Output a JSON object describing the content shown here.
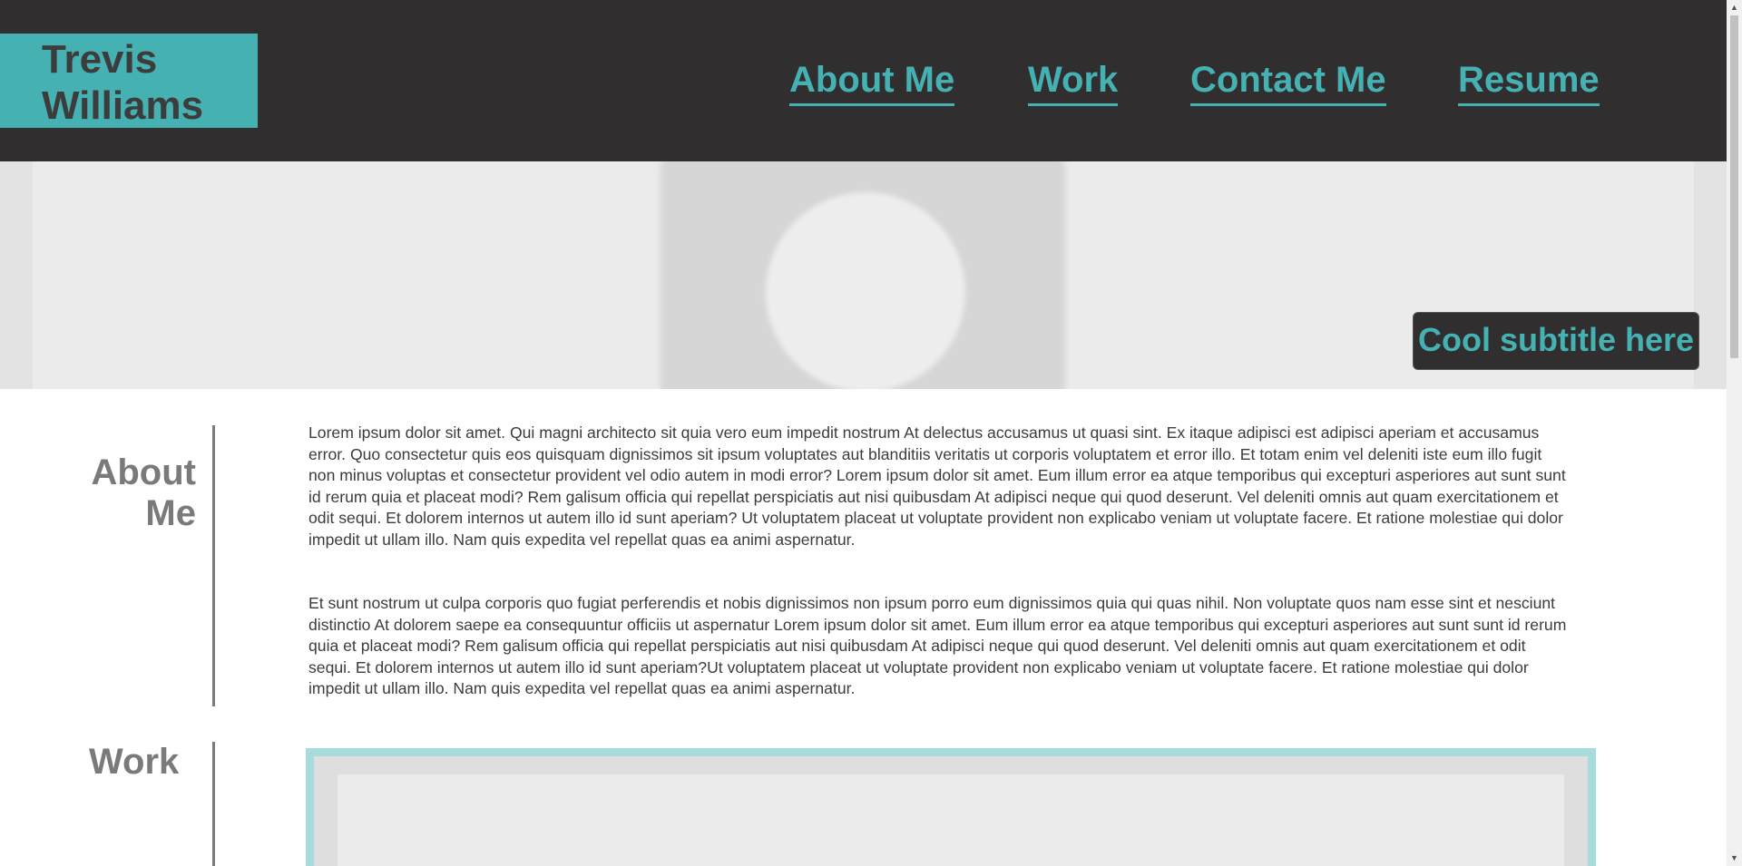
{
  "header": {
    "brand": {
      "line1": "Trevis",
      "line2": "Williams"
    },
    "nav": [
      {
        "label": "About Me"
      },
      {
        "label": "Work"
      },
      {
        "label": "Contact Me"
      },
      {
        "label": "Resume"
      }
    ]
  },
  "hero": {
    "subtitle": "Cool subtitle here"
  },
  "about": {
    "title_line1": "About",
    "title_line2": "Me",
    "paragraphs": [
      "Lorem ipsum dolor sit amet. Qui magni architecto sit quia vero eum impedit nostrum At delectus accusamus ut quasi sint. Ex itaque adipisci est adipisci aperiam et accusamus error. Quo consectetur quis eos quisquam dignissimos sit ipsum voluptates aut blanditiis veritatis ut corporis voluptatem et error illo. Et totam enim vel deleniti iste eum illo fugit non minus voluptas et consectetur provident vel odio autem in modi error? Lorem ipsum dolor sit amet. Eum illum error ea atque temporibus qui excepturi asperiores aut sunt sunt id rerum quia et placeat modi? Rem galisum officia qui repellat perspiciatis aut nisi quibusdam At adipisci neque qui quod deserunt. Vel deleniti omnis aut quam exercitationem et odit sequi. Et dolorem internos ut autem illo id sunt aperiam? Ut voluptatem placeat ut voluptate provident non explicabo veniam ut voluptate facere. Et ratione molestiae qui dolor impedit ut ullam illo. Nam quis expedita vel repellat quas ea animi aspernatur.",
      "Et sunt nostrum ut culpa corporis quo fugiat perferendis et nobis dignissimos non ipsum porro eum dignissimos quia qui quas nihil. Non voluptate quos nam esse sint et nesciunt distinctio At dolorem saepe ea consequuntur officiis ut aspernatur Lorem ipsum dolor sit amet. Eum illum error ea atque temporibus qui excepturi asperiores aut sunt sunt id rerum quia et placeat modi? Rem galisum officia qui repellat perspiciatis aut nisi quibusdam At adipisci neque qui quod deserunt. Vel deleniti omnis aut quam exercitationem et odit sequi. Et dolorem internos ut autem illo id sunt aperiam?Ut voluptatem placeat ut voluptate provident non explicabo veniam ut voluptate facere. Et ratione molestiae qui dolor impedit ut ullam illo. Nam quis expedita vel repellat quas ea animi aspernatur."
    ]
  },
  "work": {
    "title": "Work"
  },
  "colors": {
    "accent": "#45b1b3",
    "header_bg": "#302e2f",
    "heading_gray": "#7a7a7a",
    "text": "#3c3c3c",
    "work_frame": "#a6dcdd"
  },
  "icons": {
    "scroll_up": "scroll-up-arrow-icon",
    "scroll_down": "scroll-down-arrow-icon"
  }
}
